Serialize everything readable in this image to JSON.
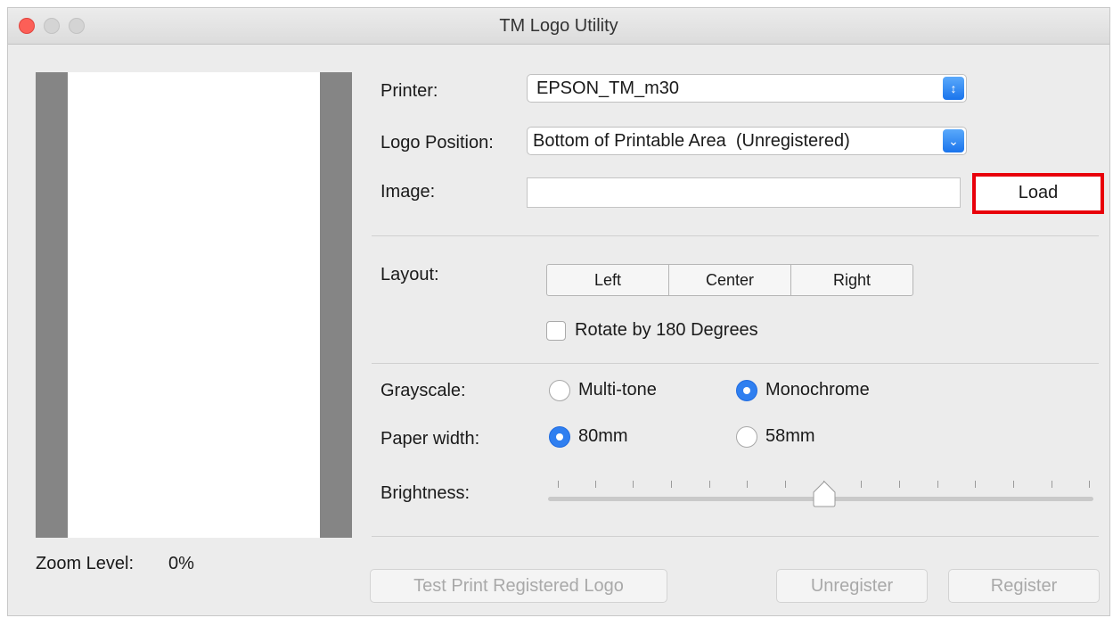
{
  "window": {
    "title": "TM Logo Utility"
  },
  "preview": {
    "zoom_label": "Zoom Level:",
    "zoom_value": "0%"
  },
  "form": {
    "printer_label": "Printer:",
    "printer_value": "EPSON_TM_m30",
    "logo_position_label": "Logo Position:",
    "logo_position_value": "Bottom of Printable Area  (Unregistered)",
    "image_label": "Image:",
    "image_value": "",
    "load_label": "Load",
    "layout_label": "Layout:",
    "layout_options": [
      "Left",
      "Center",
      "Right"
    ],
    "rotate_label": "Rotate by 180 Degrees",
    "rotate_checked": false,
    "grayscale_label": "Grayscale:",
    "grayscale_options": [
      "Multi-tone",
      "Monochrome"
    ],
    "grayscale_selected": "Monochrome",
    "paper_width_label": "Paper width:",
    "paper_width_options": [
      "80mm",
      "58mm"
    ],
    "paper_width_selected": "80mm",
    "brightness_label": "Brightness:",
    "brightness_value": 0.5
  },
  "buttons": {
    "test_print": "Test Print Registered Logo",
    "unregister": "Unregister",
    "register": "Register"
  },
  "colors": {
    "accent": "#2f7ff0",
    "highlight": "#e8000b"
  }
}
